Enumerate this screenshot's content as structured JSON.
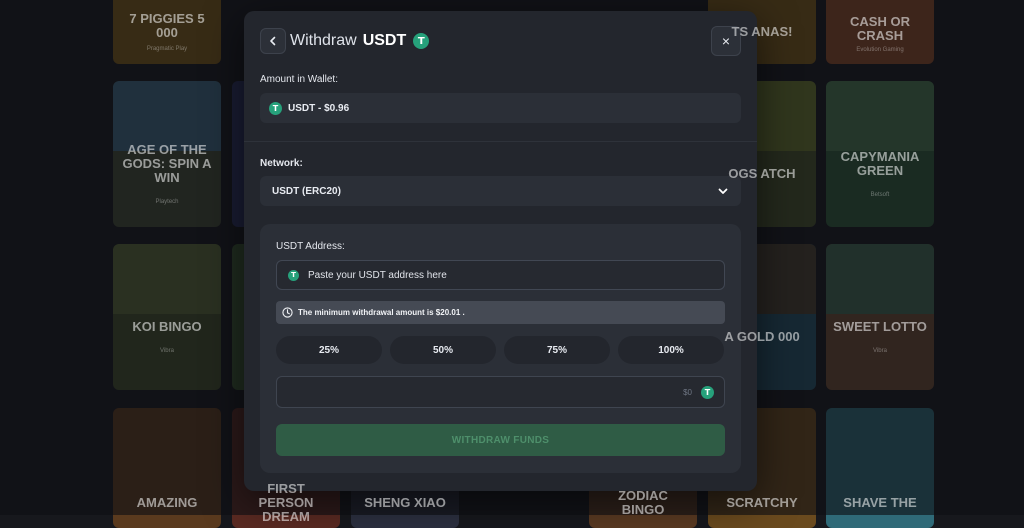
{
  "background": {
    "games": [
      {
        "name": "7 PIGGIES 5 000",
        "sub": "Pragmatic Play"
      },
      {
        "name": "",
        "sub": ""
      },
      {
        "name": "TS ANAS!",
        "sub": ""
      },
      {
        "name": "CASH OR CRASH",
        "sub": "Evolution Gaming"
      },
      {
        "name": "AGE OF THE GODS: SPIN A WIN",
        "sub": "Playtech"
      },
      {
        "name": "OGS ATCH",
        "sub": ""
      },
      {
        "name": "CAPYMANIA GREEN",
        "sub": "Betsoft"
      },
      {
        "name": "KOI BINGO",
        "sub": "Vibra"
      },
      {
        "name": "A GOLD 000",
        "sub": ""
      },
      {
        "name": "SWEET LOTTO",
        "sub": "Vibra"
      },
      {
        "name": "AMAZING",
        "sub": ""
      },
      {
        "name": "FIRST PERSON DREAM",
        "sub": ""
      },
      {
        "name": "SHENG XIAO",
        "sub": ""
      },
      {
        "name": "ZODIAC BINGO",
        "sub": ""
      },
      {
        "name": "SCRATCHY",
        "sub": ""
      },
      {
        "name": "SHAVE THE",
        "sub": ""
      }
    ]
  },
  "modal": {
    "title_prefix": "Withdraw",
    "title_currency": "USDT",
    "currency_symbol": "T",
    "close_symbol": "×",
    "wallet_label": "Amount in Wallet:",
    "wallet_value": "USDT - $0.96",
    "network_label": "Network:",
    "network_value": "USDT (ERC20)",
    "address_label": "USDT Address:",
    "address_placeholder": "Paste your USDT address here",
    "min_notice": "The minimum withdrawal amount is $20.01 .",
    "percent_buttons": [
      "25%",
      "50%",
      "75%",
      "100%"
    ],
    "amount_value": "$0",
    "withdraw_label": "WITHDRAW FUNDS"
  },
  "colors": {
    "accent_green": "#26a17b",
    "withdraw_button": "#2f5c45"
  }
}
